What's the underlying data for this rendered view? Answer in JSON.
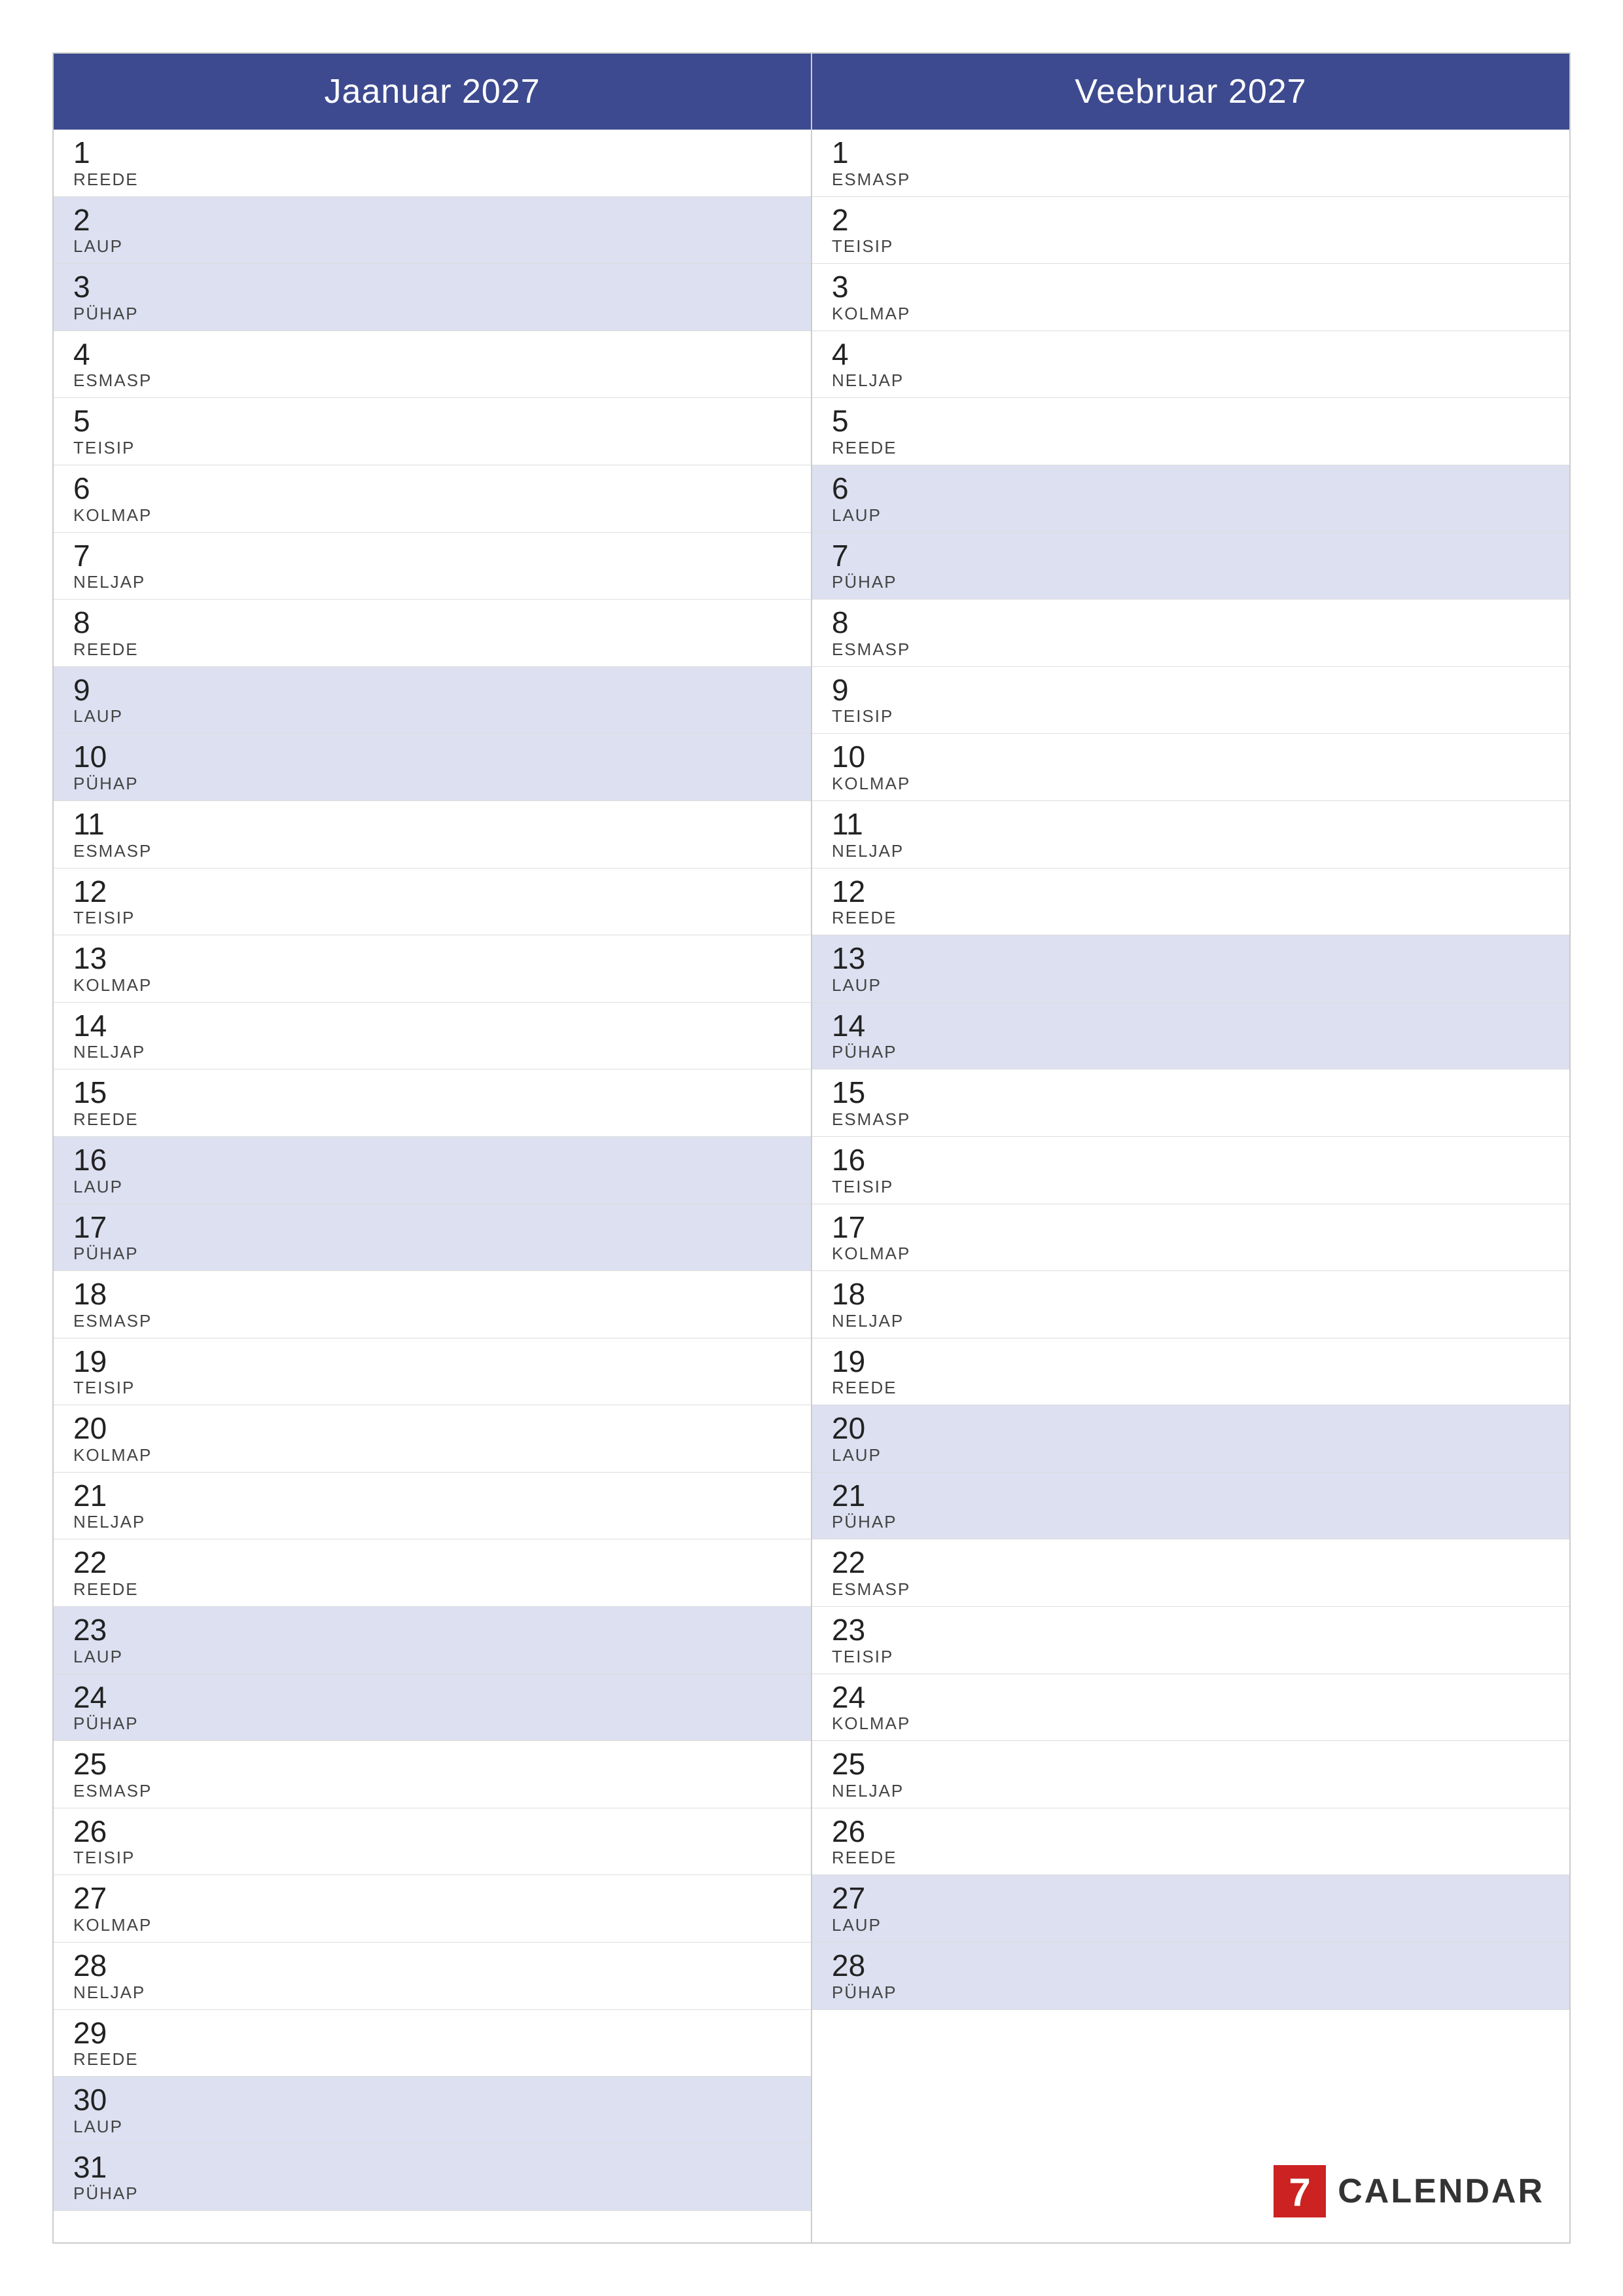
{
  "months": [
    {
      "name": "Jaanuar 2027",
      "days": [
        {
          "num": "1",
          "name": "REEDE",
          "weekend": false
        },
        {
          "num": "2",
          "name": "LAUP",
          "weekend": true
        },
        {
          "num": "3",
          "name": "PÜHAP",
          "weekend": true
        },
        {
          "num": "4",
          "name": "ESMASP",
          "weekend": false
        },
        {
          "num": "5",
          "name": "TEISIP",
          "weekend": false
        },
        {
          "num": "6",
          "name": "KOLMAP",
          "weekend": false
        },
        {
          "num": "7",
          "name": "NELJAP",
          "weekend": false
        },
        {
          "num": "8",
          "name": "REEDE",
          "weekend": false
        },
        {
          "num": "9",
          "name": "LAUP",
          "weekend": true
        },
        {
          "num": "10",
          "name": "PÜHAP",
          "weekend": true
        },
        {
          "num": "11",
          "name": "ESMASP",
          "weekend": false
        },
        {
          "num": "12",
          "name": "TEISIP",
          "weekend": false
        },
        {
          "num": "13",
          "name": "KOLMAP",
          "weekend": false
        },
        {
          "num": "14",
          "name": "NELJAP",
          "weekend": false
        },
        {
          "num": "15",
          "name": "REEDE",
          "weekend": false
        },
        {
          "num": "16",
          "name": "LAUP",
          "weekend": true
        },
        {
          "num": "17",
          "name": "PÜHAP",
          "weekend": true
        },
        {
          "num": "18",
          "name": "ESMASP",
          "weekend": false
        },
        {
          "num": "19",
          "name": "TEISIP",
          "weekend": false
        },
        {
          "num": "20",
          "name": "KOLMAP",
          "weekend": false
        },
        {
          "num": "21",
          "name": "NELJAP",
          "weekend": false
        },
        {
          "num": "22",
          "name": "REEDE",
          "weekend": false
        },
        {
          "num": "23",
          "name": "LAUP",
          "weekend": true
        },
        {
          "num": "24",
          "name": "PÜHAP",
          "weekend": true
        },
        {
          "num": "25",
          "name": "ESMASP",
          "weekend": false
        },
        {
          "num": "26",
          "name": "TEISIP",
          "weekend": false
        },
        {
          "num": "27",
          "name": "KOLMAP",
          "weekend": false
        },
        {
          "num": "28",
          "name": "NELJAP",
          "weekend": false
        },
        {
          "num": "29",
          "name": "REEDE",
          "weekend": false
        },
        {
          "num": "30",
          "name": "LAUP",
          "weekend": true
        },
        {
          "num": "31",
          "name": "PÜHAP",
          "weekend": true
        }
      ]
    },
    {
      "name": "Veebruar 2027",
      "days": [
        {
          "num": "1",
          "name": "ESMASP",
          "weekend": false
        },
        {
          "num": "2",
          "name": "TEISIP",
          "weekend": false
        },
        {
          "num": "3",
          "name": "KOLMAP",
          "weekend": false
        },
        {
          "num": "4",
          "name": "NELJAP",
          "weekend": false
        },
        {
          "num": "5",
          "name": "REEDE",
          "weekend": false
        },
        {
          "num": "6",
          "name": "LAUP",
          "weekend": true
        },
        {
          "num": "7",
          "name": "PÜHAP",
          "weekend": true
        },
        {
          "num": "8",
          "name": "ESMASP",
          "weekend": false
        },
        {
          "num": "9",
          "name": "TEISIP",
          "weekend": false
        },
        {
          "num": "10",
          "name": "KOLMAP",
          "weekend": false
        },
        {
          "num": "11",
          "name": "NELJAP",
          "weekend": false
        },
        {
          "num": "12",
          "name": "REEDE",
          "weekend": false
        },
        {
          "num": "13",
          "name": "LAUP",
          "weekend": true
        },
        {
          "num": "14",
          "name": "PÜHAP",
          "weekend": true
        },
        {
          "num": "15",
          "name": "ESMASP",
          "weekend": false
        },
        {
          "num": "16",
          "name": "TEISIP",
          "weekend": false
        },
        {
          "num": "17",
          "name": "KOLMAP",
          "weekend": false
        },
        {
          "num": "18",
          "name": "NELJAP",
          "weekend": false
        },
        {
          "num": "19",
          "name": "REEDE",
          "weekend": false
        },
        {
          "num": "20",
          "name": "LAUP",
          "weekend": true
        },
        {
          "num": "21",
          "name": "PÜHAP",
          "weekend": true
        },
        {
          "num": "22",
          "name": "ESMASP",
          "weekend": false
        },
        {
          "num": "23",
          "name": "TEISIP",
          "weekend": false
        },
        {
          "num": "24",
          "name": "KOLMAP",
          "weekend": false
        },
        {
          "num": "25",
          "name": "NELJAP",
          "weekend": false
        },
        {
          "num": "26",
          "name": "REEDE",
          "weekend": false
        },
        {
          "num": "27",
          "name": "LAUP",
          "weekend": true
        },
        {
          "num": "28",
          "name": "PÜHAP",
          "weekend": true
        }
      ]
    }
  ],
  "logo": {
    "number": "7",
    "text": "CALENDAR"
  }
}
